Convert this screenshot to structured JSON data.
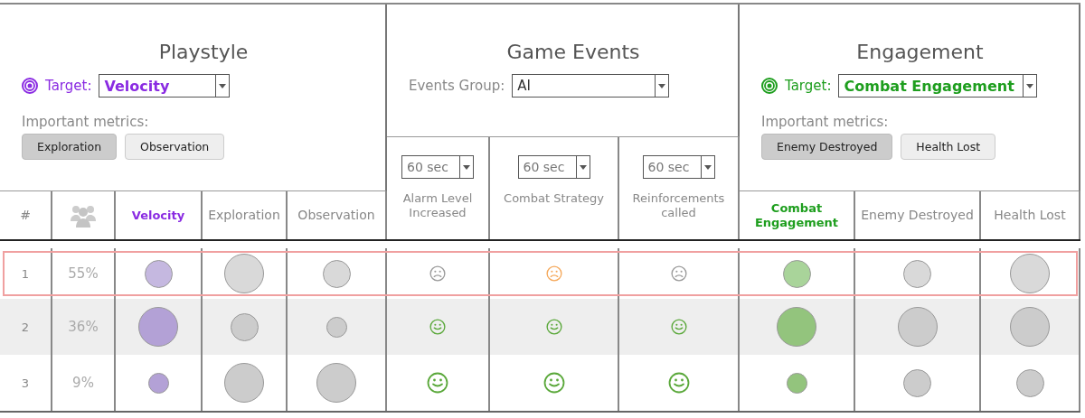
{
  "playstyle": {
    "title": "Playstyle",
    "target_label": "Target:",
    "target_value": "Velocity",
    "metrics_label": "Important metrics:",
    "metrics": [
      {
        "label": "Exploration",
        "selected": true
      },
      {
        "label": "Observation",
        "selected": false
      }
    ],
    "color": "#8a2be2"
  },
  "game_events": {
    "title": "Game Events",
    "group_label": "Events Group:",
    "group_value": "AI",
    "events": [
      {
        "interval": "60 sec",
        "label": "Alarm Level Increased"
      },
      {
        "interval": "60 sec",
        "label": "Combat Strategy"
      },
      {
        "interval": "60 sec",
        "label": "Reinforcements called"
      }
    ]
  },
  "engagement": {
    "title": "Engagement",
    "target_label": "Target:",
    "target_value": "Combat Engagement",
    "metrics_label": "Important metrics:",
    "metrics": [
      {
        "label": "Enemy Destroyed",
        "selected": true
      },
      {
        "label": "Health Lost",
        "selected": false
      }
    ],
    "color": "#1e9e1e"
  },
  "columns": [
    {
      "kind": "index",
      "label": "#"
    },
    {
      "kind": "players"
    },
    {
      "kind": "metric",
      "label": "Velocity",
      "target": true,
      "color": "#8a2be2"
    },
    {
      "kind": "metric",
      "label": "Exploration",
      "target": false
    },
    {
      "kind": "metric",
      "label": "Observation",
      "target": false
    },
    {
      "kind": "event"
    },
    {
      "kind": "event"
    },
    {
      "kind": "event"
    },
    {
      "kind": "metric",
      "label": "Combat Engagement",
      "target": true,
      "color": "#1e9e1e"
    },
    {
      "kind": "metric",
      "label": "Enemy Destroyed",
      "target": false
    },
    {
      "kind": "metric",
      "label": "Health Lost",
      "target": false
    }
  ],
  "rows": [
    {
      "index": "1",
      "share": "55%",
      "selected": true,
      "cells": [
        {
          "kind": "bubble",
          "large": false,
          "small": false,
          "color": "#c5b8e0"
        },
        {
          "kind": "bubble",
          "large": true,
          "small": false,
          "color": "#d9d9d9"
        },
        {
          "kind": "bubble",
          "large": false,
          "small": false,
          "color": "#d9d9d9"
        },
        {
          "kind": "sad",
          "large": false,
          "color": "#9a9a9a"
        },
        {
          "kind": "sad",
          "large": false,
          "color": "#f5a85a"
        },
        {
          "kind": "sad",
          "large": false,
          "color": "#9a9a9a"
        },
        {
          "kind": "bubble",
          "large": false,
          "small": false,
          "color": "#a9d49a"
        },
        {
          "kind": "bubble",
          "large": false,
          "small": false,
          "color": "#d9d9d9"
        },
        {
          "kind": "bubble",
          "large": true,
          "small": false,
          "color": "#d9d9d9"
        }
      ]
    },
    {
      "index": "2",
      "share": "36%",
      "selected": false,
      "cells": [
        {
          "kind": "bubble",
          "large": true,
          "small": false,
          "color": "#b3a1d6"
        },
        {
          "kind": "bubble",
          "large": false,
          "small": false,
          "color": "#cccccc"
        },
        {
          "kind": "bubble",
          "large": false,
          "small": true,
          "color": "#cccccc"
        },
        {
          "kind": "happy",
          "large": false,
          "color": "#5aa83a"
        },
        {
          "kind": "happy",
          "large": false,
          "color": "#5aa83a"
        },
        {
          "kind": "happy",
          "large": false,
          "color": "#5aa83a"
        },
        {
          "kind": "bubble",
          "large": true,
          "small": false,
          "color": "#93c47d"
        },
        {
          "kind": "bubble",
          "large": true,
          "small": false,
          "color": "#cccccc"
        },
        {
          "kind": "bubble",
          "large": true,
          "small": false,
          "color": "#cccccc"
        }
      ]
    },
    {
      "index": "3",
      "share": "9%",
      "selected": false,
      "cells": [
        {
          "kind": "bubble",
          "large": false,
          "small": true,
          "color": "#b3a1d6"
        },
        {
          "kind": "bubble",
          "large": true,
          "small": false,
          "color": "#cccccc"
        },
        {
          "kind": "bubble",
          "large": true,
          "small": false,
          "color": "#cccccc"
        },
        {
          "kind": "happy",
          "large": true,
          "color": "#5aa83a"
        },
        {
          "kind": "happy",
          "large": true,
          "color": "#5aa83a"
        },
        {
          "kind": "happy",
          "large": true,
          "color": "#5aa83a"
        },
        {
          "kind": "bubble",
          "large": false,
          "small": true,
          "color": "#93c47d"
        },
        {
          "kind": "bubble",
          "large": false,
          "small": false,
          "color": "#cccccc"
        },
        {
          "kind": "bubble",
          "large": false,
          "small": false,
          "color": "#cccccc"
        }
      ]
    }
  ]
}
